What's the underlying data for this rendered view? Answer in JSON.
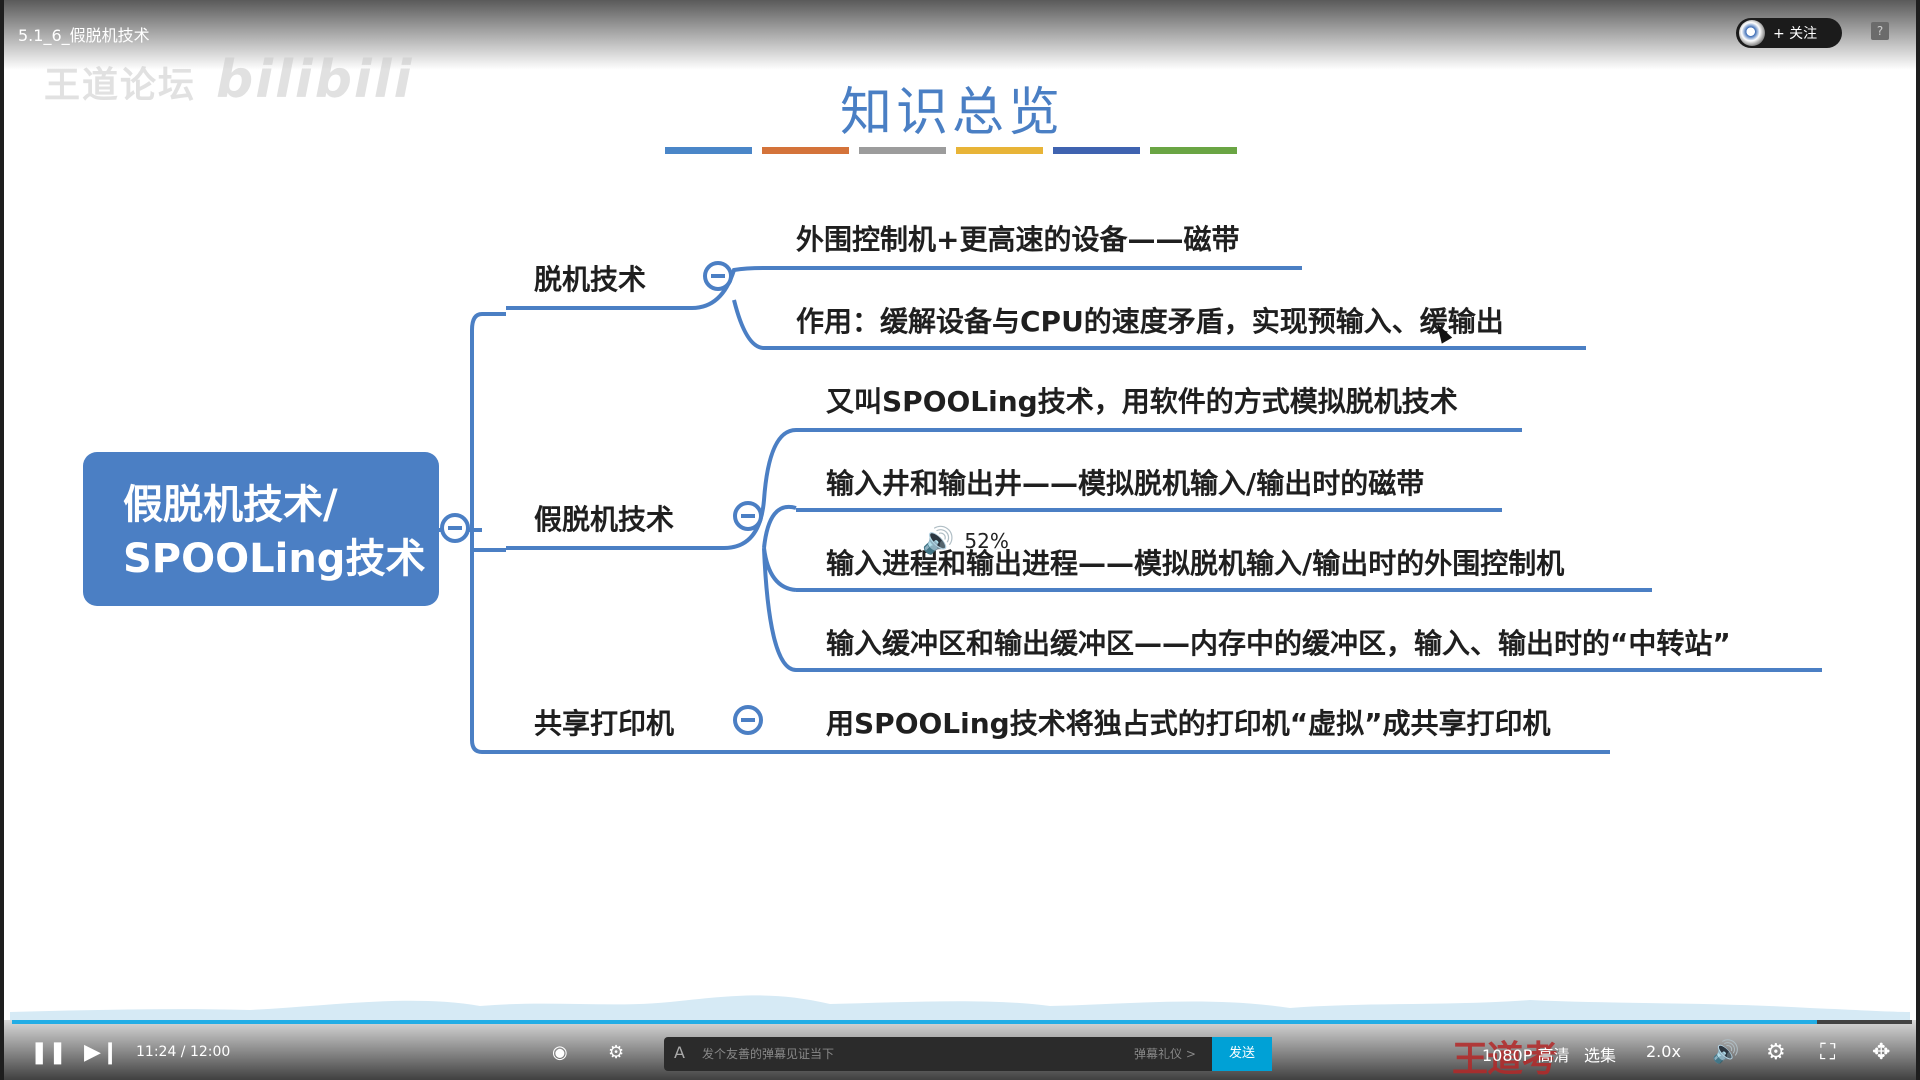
{
  "player": {
    "video_title": "5.1_6_假脱机技术",
    "watermark_text": "王道论坛",
    "watermark_logo": "bilibili",
    "follow_label": "+ 关注",
    "help_label": "?"
  },
  "slide": {
    "title": "知识总览",
    "color_bars": [
      "#4a86c8",
      "#d4733a",
      "#9c9c9c",
      "#e8b437",
      "#3f63b0",
      "#6aa544"
    ],
    "root": {
      "line1": "假脱机技术/",
      "line2": "SPOOLing技术"
    },
    "branches": [
      {
        "label": "脱机技术",
        "leaves": [
          "外围控制机+更高速的设备——磁带",
          "作用：缓解设备与CPU的速度矛盾，实现预输入、缓输出"
        ]
      },
      {
        "label": "假脱机技术",
        "leaves": [
          "又叫SPOOLing技术，用软件的方式模拟脱机技术",
          "输入井和输出井——模拟脱机输入/输出时的磁带",
          "输入进程和输出进程——模拟脱机输入/输出时的外围控制机",
          "输入缓冲区和输出缓冲区——内存中的缓冲区，输入、输出时的“中转站”"
        ]
      },
      {
        "label": "共享打印机",
        "leaves": [
          "用SPOOLing技术将独占式的打印机“虚拟”成共享打印机"
        ]
      }
    ],
    "accent_color": "#4a7fc4"
  },
  "overlay": {
    "volume_percent": "52%"
  },
  "controls": {
    "time": "11:24 / 12:00",
    "progress": 0.95,
    "danmaku_placeholder": "发个友善的弹幕见证当下",
    "danmaku_etiquette": "弹幕礼仪 >",
    "send_label": "发送",
    "quality_label": "1080P 高清",
    "episodes_label": "选集",
    "speed_label": "2.0x",
    "brand_watermark": "王道考研/CSKAOYAN.COM"
  }
}
